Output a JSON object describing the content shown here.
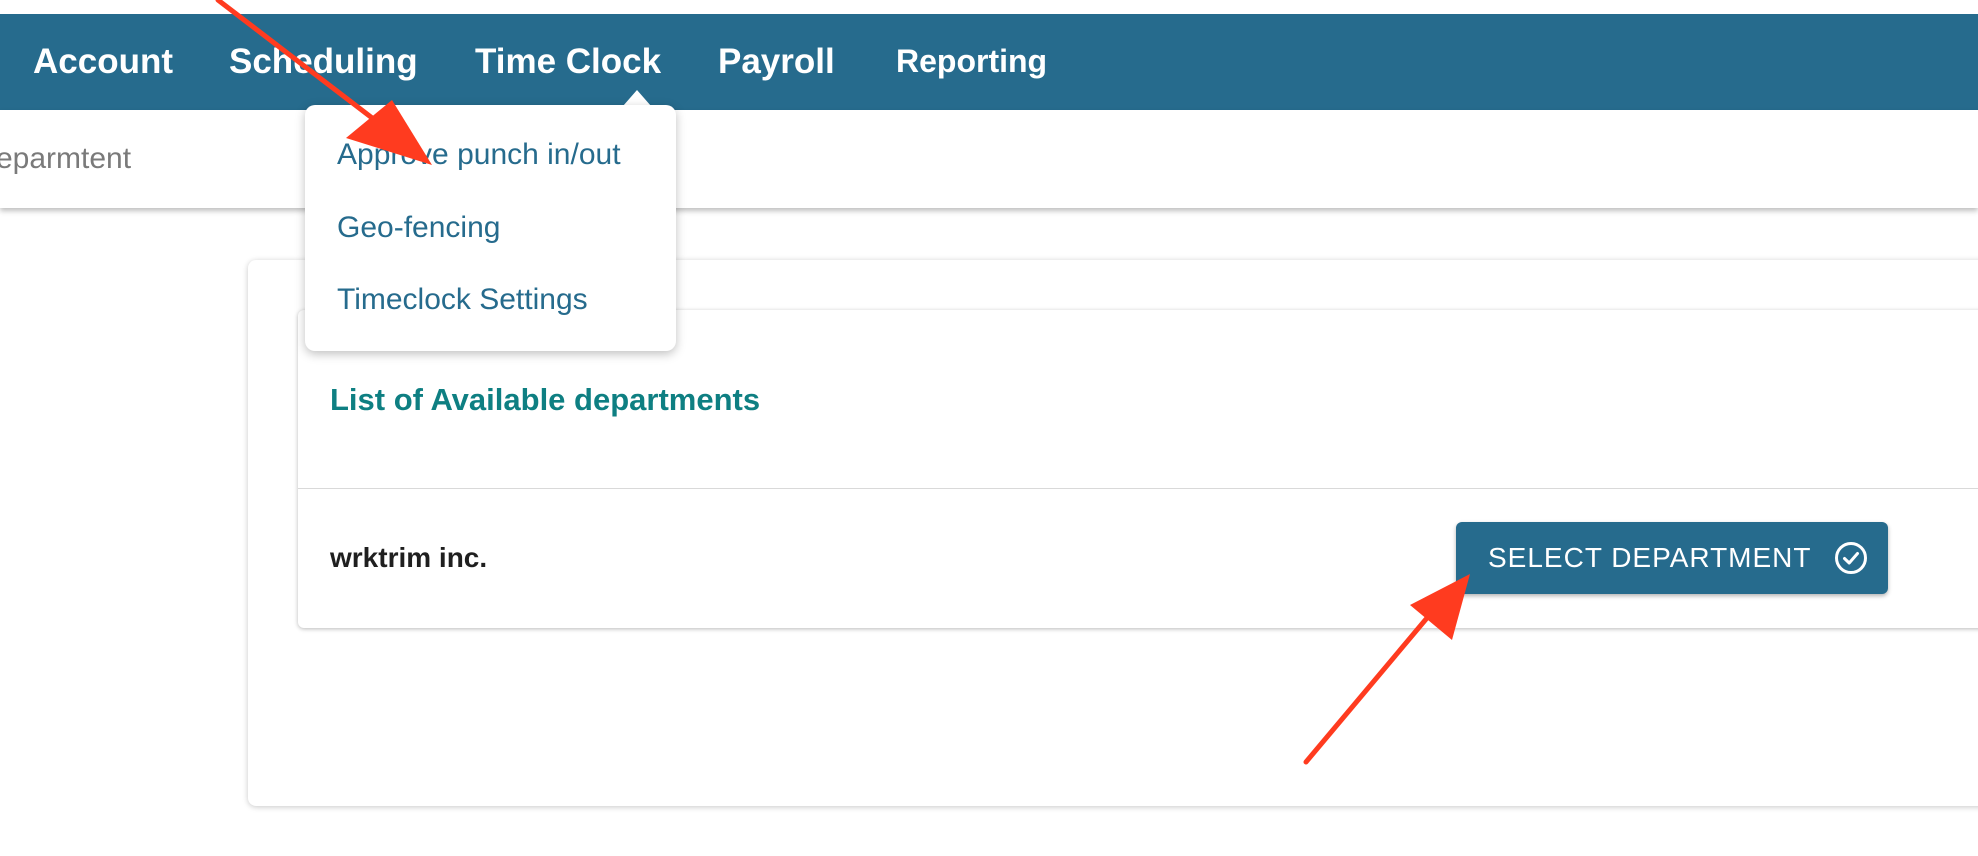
{
  "nav": {
    "items": [
      {
        "label": "Account"
      },
      {
        "label": "Scheduling"
      },
      {
        "label": "Time Clock"
      },
      {
        "label": "Payroll"
      },
      {
        "label": "Reporting"
      }
    ]
  },
  "breadcrumb": {
    "text": "eparmtent"
  },
  "dropdown": {
    "items": [
      {
        "label": "Approve punch in/out"
      },
      {
        "label": "Geo-fencing"
      },
      {
        "label": "Timeclock Settings"
      }
    ]
  },
  "departments_card": {
    "title": "List of Available departments",
    "rows": [
      {
        "name": "wrktrim inc.",
        "action_label": "SELECT DEPARTMENT"
      }
    ]
  },
  "colors": {
    "primary": "#266b8d",
    "title_teal": "#0e7f82",
    "annotation_arrow": "#ff3b1f"
  },
  "icons": {
    "button_icon": "check-circle-icon"
  }
}
